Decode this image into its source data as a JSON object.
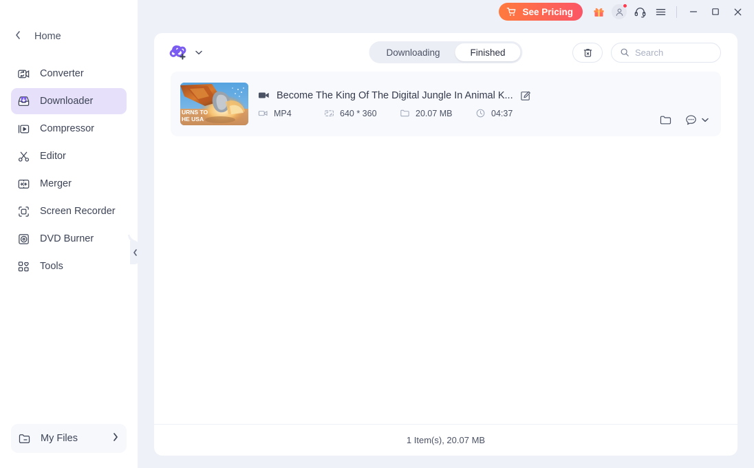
{
  "titlebar": {
    "pricing_label": "See Pricing",
    "icons": [
      "cart-icon",
      "gift-icon",
      "user-avatar-icon",
      "headset-icon",
      "hamburger-menu-icon"
    ],
    "window_controls": [
      "minimize-icon",
      "maximize-icon",
      "close-icon"
    ]
  },
  "sidebar": {
    "home_label": "Home",
    "items": [
      {
        "label": "Converter",
        "icon": "converter-icon",
        "active": false
      },
      {
        "label": "Downloader",
        "icon": "downloader-icon",
        "active": true
      },
      {
        "label": "Compressor",
        "icon": "compressor-icon",
        "active": false
      },
      {
        "label": "Editor",
        "icon": "scissors-icon",
        "active": false
      },
      {
        "label": "Merger",
        "icon": "merger-icon",
        "active": false
      },
      {
        "label": "Screen Recorder",
        "icon": "screen-recorder-icon",
        "active": false
      },
      {
        "label": "DVD Burner",
        "icon": "dvd-burner-icon",
        "active": false
      },
      {
        "label": "Tools",
        "icon": "tools-grid-icon",
        "active": false
      }
    ],
    "my_files_label": "My Files",
    "collapse_icon": "chevron-left-icon"
  },
  "toolbar": {
    "add_link_icon": "add-link-icon",
    "add_link_chevron": "chevron-down-icon",
    "tabs": [
      {
        "label": "Downloading",
        "active": false
      },
      {
        "label": "Finished",
        "active": true
      }
    ],
    "clear_icon": "trash-icon",
    "search": {
      "placeholder": "Search",
      "value": ""
    }
  },
  "downloads": [
    {
      "title": "Become The King Of The Digital Jungle In Animal K...",
      "format": "MP4",
      "resolution": "640 * 360",
      "size": "20.07 MB",
      "duration": "04:37",
      "thumbnail_text_1": "URNS TO",
      "thumbnail_text_2": "HE USA",
      "edit_icon": "edit-pencil-icon",
      "folder_icon": "folder-icon",
      "more_icon": "more-options-icon"
    }
  ],
  "statusbar": {
    "summary": "1 Item(s), 20.07 MB"
  },
  "colors": {
    "accent_purple": "#7a5cf0",
    "active_nav_bg": "#e7e0fb",
    "pricing_gradient_start": "#ff7a3d",
    "pricing_gradient_end": "#fb5566",
    "app_bg": "#eef1f8",
    "panel_bg": "#ffffff",
    "row_bg": "#f7f9fc",
    "badge_red": "#ff3b4e"
  }
}
